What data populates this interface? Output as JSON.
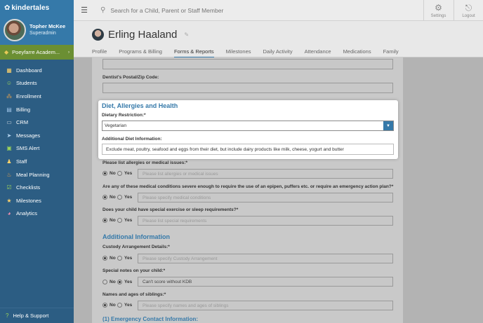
{
  "brand": {
    "name": "kindertales"
  },
  "user": {
    "name": "Topher McKee",
    "role": "Superadmin"
  },
  "school": {
    "name": "Poeyfarre Academ..."
  },
  "nav": [
    {
      "label": "Dashboard",
      "icon": "dashboard-icon"
    },
    {
      "label": "Students",
      "icon": "students-icon"
    },
    {
      "label": "Enrollment",
      "icon": "enrollment-icon"
    },
    {
      "label": "Billing",
      "icon": "billing-icon"
    },
    {
      "label": "CRM",
      "icon": "crm-icon"
    },
    {
      "label": "Messages",
      "icon": "messages-icon"
    },
    {
      "label": "SMS Alert",
      "icon": "sms-icon"
    },
    {
      "label": "Staff",
      "icon": "staff-icon"
    },
    {
      "label": "Meal Planning",
      "icon": "meal-icon"
    },
    {
      "label": "Checklists",
      "icon": "checklist-icon"
    },
    {
      "label": "Milestones",
      "icon": "milestones-icon"
    },
    {
      "label": "Analytics",
      "icon": "analytics-icon"
    }
  ],
  "help": {
    "label": "Help & Support"
  },
  "search": {
    "placeholder": "Search for a Child, Parent or Staff Member"
  },
  "topbar": {
    "settings_label": "Settings",
    "logout_label": "Logout"
  },
  "child": {
    "name": "Erling Haaland"
  },
  "tabs": [
    {
      "label": "Profile"
    },
    {
      "label": "Programs & Billing"
    },
    {
      "label": "Forms & Reports",
      "active": true
    },
    {
      "label": "Milestones"
    },
    {
      "label": "Daily Activity"
    },
    {
      "label": "Attendance"
    },
    {
      "label": "Medications"
    },
    {
      "label": "Family"
    }
  ],
  "form": {
    "postal_label": "Dentist's Postal/Zip Code:",
    "diet_section": "Diet, Allergies and Health",
    "dietary_label": "Dietary Restriction:*",
    "dietary_value": "Vegetarian",
    "diet_info_label": "Additional Diet Information:",
    "diet_info_value": "Exclude meat, poultry, seafood and eggs from their diet, but include dairy products like milk, cheese, yogurt and butter",
    "allergies_label": "Please list allergies or medical issues:*",
    "allergies_placeholder": "Please list allergies or medical issues",
    "epipen_label": "Are any of these medical conditions severe enough to require the use of an epipen, puffers etc. or require an emergency action plan?*",
    "epipen_placeholder": "Please specify medical conditions",
    "exercise_label": "Does your child have special exercise or sleep requirements?*",
    "exercise_placeholder": "Please list special requirements",
    "additional_section": "Additional Information",
    "custody_label": "Custody Arrangement Details:*",
    "custody_placeholder": "Please specify Custody Arrangement",
    "special_notes_label": "Special notes on your child:*",
    "special_notes_value": "Can't score without KDB",
    "siblings_label": "Names and ages of siblings:*",
    "siblings_placeholder": "Please specify names and ages of siblings",
    "emergency_section": "(1) Emergency Contact Information:",
    "no_label": "No",
    "yes_label": "Yes"
  }
}
